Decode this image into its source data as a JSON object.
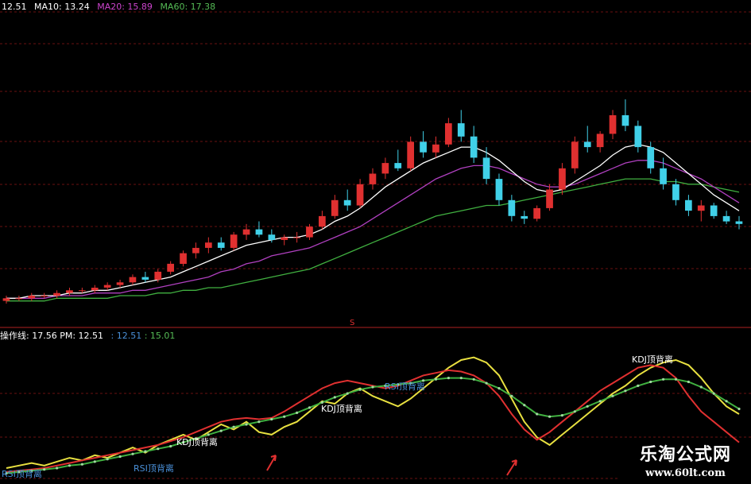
{
  "main_legend": {
    "price": "12.51",
    "ma10": "MA10: 13.24",
    "ma20": "MA20: 15.89",
    "ma60": "MA60: 17.38",
    "colors": {
      "price": "#ffffff",
      "ma10": "#ffffff",
      "ma20": "#cc44cc",
      "ma60": "#55bb55"
    }
  },
  "sub_legend": {
    "label": "操作线: 17.56  PM: 12.51",
    "v1": ": 12.51",
    "v2": ": 15.01",
    "colors": {
      "label": "#ffffff",
      "v1": "#4a90d9",
      "v2": "#55bb55"
    }
  },
  "divider_marker": "S",
  "watermark": {
    "name": "乐淘公式网",
    "url": "www.60lt.com"
  },
  "chart_data": [
    {
      "type": "candlestick",
      "title": "",
      "ylim": [
        0.25,
        1.05
      ],
      "note": "normalized price scale; no axis printed",
      "series_colors": {
        "up": "#e03030",
        "down": "#40d0e8",
        "ma10": "#ffffff",
        "ma5": "#e8d8a0",
        "ma20": "#b040c0",
        "ma60": "#40b040"
      },
      "candles": [
        {
          "o": 0.26,
          "h": 0.28,
          "l": 0.25,
          "c": 0.27
        },
        {
          "o": 0.27,
          "h": 0.28,
          "l": 0.26,
          "c": 0.27
        },
        {
          "o": 0.27,
          "h": 0.29,
          "l": 0.26,
          "c": 0.28
        },
        {
          "o": 0.28,
          "h": 0.29,
          "l": 0.27,
          "c": 0.28
        },
        {
          "o": 0.28,
          "h": 0.3,
          "l": 0.27,
          "c": 0.29
        },
        {
          "o": 0.29,
          "h": 0.31,
          "l": 0.28,
          "c": 0.3
        },
        {
          "o": 0.3,
          "h": 0.31,
          "l": 0.29,
          "c": 0.3
        },
        {
          "o": 0.3,
          "h": 0.32,
          "l": 0.29,
          "c": 0.31
        },
        {
          "o": 0.31,
          "h": 0.33,
          "l": 0.3,
          "c": 0.32
        },
        {
          "o": 0.32,
          "h": 0.34,
          "l": 0.31,
          "c": 0.33
        },
        {
          "o": 0.33,
          "h": 0.36,
          "l": 0.32,
          "c": 0.35
        },
        {
          "o": 0.35,
          "h": 0.37,
          "l": 0.33,
          "c": 0.34
        },
        {
          "o": 0.34,
          "h": 0.38,
          "l": 0.33,
          "c": 0.37
        },
        {
          "o": 0.37,
          "h": 0.41,
          "l": 0.36,
          "c": 0.4
        },
        {
          "o": 0.4,
          "h": 0.45,
          "l": 0.39,
          "c": 0.44
        },
        {
          "o": 0.44,
          "h": 0.48,
          "l": 0.42,
          "c": 0.46
        },
        {
          "o": 0.46,
          "h": 0.5,
          "l": 0.44,
          "c": 0.48
        },
        {
          "o": 0.48,
          "h": 0.5,
          "l": 0.45,
          "c": 0.46
        },
        {
          "o": 0.46,
          "h": 0.52,
          "l": 0.45,
          "c": 0.51
        },
        {
          "o": 0.51,
          "h": 0.55,
          "l": 0.49,
          "c": 0.53
        },
        {
          "o": 0.53,
          "h": 0.56,
          "l": 0.5,
          "c": 0.51
        },
        {
          "o": 0.51,
          "h": 0.53,
          "l": 0.48,
          "c": 0.49
        },
        {
          "o": 0.49,
          "h": 0.51,
          "l": 0.47,
          "c": 0.5
        },
        {
          "o": 0.5,
          "h": 0.52,
          "l": 0.48,
          "c": 0.5
        },
        {
          "o": 0.5,
          "h": 0.55,
          "l": 0.49,
          "c": 0.54
        },
        {
          "o": 0.54,
          "h": 0.6,
          "l": 0.53,
          "c": 0.58
        },
        {
          "o": 0.58,
          "h": 0.66,
          "l": 0.57,
          "c": 0.64
        },
        {
          "o": 0.64,
          "h": 0.68,
          "l": 0.6,
          "c": 0.62
        },
        {
          "o": 0.62,
          "h": 0.72,
          "l": 0.61,
          "c": 0.7
        },
        {
          "o": 0.7,
          "h": 0.76,
          "l": 0.68,
          "c": 0.74
        },
        {
          "o": 0.74,
          "h": 0.8,
          "l": 0.72,
          "c": 0.78
        },
        {
          "o": 0.78,
          "h": 0.83,
          "l": 0.75,
          "c": 0.76
        },
        {
          "o": 0.76,
          "h": 0.88,
          "l": 0.75,
          "c": 0.86
        },
        {
          "o": 0.86,
          "h": 0.9,
          "l": 0.8,
          "c": 0.82
        },
        {
          "o": 0.82,
          "h": 0.88,
          "l": 0.8,
          "c": 0.85
        },
        {
          "o": 0.85,
          "h": 0.95,
          "l": 0.84,
          "c": 0.93
        },
        {
          "o": 0.93,
          "h": 0.98,
          "l": 0.86,
          "c": 0.88
        },
        {
          "o": 0.88,
          "h": 0.92,
          "l": 0.78,
          "c": 0.8
        },
        {
          "o": 0.8,
          "h": 0.84,
          "l": 0.7,
          "c": 0.72
        },
        {
          "o": 0.72,
          "h": 0.74,
          "l": 0.62,
          "c": 0.64
        },
        {
          "o": 0.64,
          "h": 0.66,
          "l": 0.56,
          "c": 0.58
        },
        {
          "o": 0.58,
          "h": 0.6,
          "l": 0.55,
          "c": 0.57
        },
        {
          "o": 0.57,
          "h": 0.62,
          "l": 0.56,
          "c": 0.61
        },
        {
          "o": 0.61,
          "h": 0.7,
          "l": 0.6,
          "c": 0.68
        },
        {
          "o": 0.68,
          "h": 0.78,
          "l": 0.66,
          "c": 0.76
        },
        {
          "o": 0.76,
          "h": 0.88,
          "l": 0.74,
          "c": 0.86
        },
        {
          "o": 0.86,
          "h": 0.92,
          "l": 0.82,
          "c": 0.84
        },
        {
          "o": 0.84,
          "h": 0.9,
          "l": 0.82,
          "c": 0.89
        },
        {
          "o": 0.89,
          "h": 0.98,
          "l": 0.87,
          "c": 0.96
        },
        {
          "o": 0.96,
          "h": 1.02,
          "l": 0.9,
          "c": 0.92
        },
        {
          "o": 0.92,
          "h": 0.94,
          "l": 0.82,
          "c": 0.84
        },
        {
          "o": 0.84,
          "h": 0.86,
          "l": 0.74,
          "c": 0.76
        },
        {
          "o": 0.76,
          "h": 0.8,
          "l": 0.68,
          "c": 0.7
        },
        {
          "o": 0.7,
          "h": 0.72,
          "l": 0.62,
          "c": 0.64
        },
        {
          "o": 0.64,
          "h": 0.66,
          "l": 0.58,
          "c": 0.6
        },
        {
          "o": 0.6,
          "h": 0.64,
          "l": 0.56,
          "c": 0.62
        },
        {
          "o": 0.62,
          "h": 0.63,
          "l": 0.57,
          "c": 0.58
        },
        {
          "o": 0.58,
          "h": 0.6,
          "l": 0.55,
          "c": 0.56
        },
        {
          "o": 0.56,
          "h": 0.58,
          "l": 0.53,
          "c": 0.55
        }
      ],
      "ma10": [
        0.27,
        0.27,
        0.28,
        0.28,
        0.28,
        0.29,
        0.29,
        0.3,
        0.3,
        0.31,
        0.32,
        0.33,
        0.34,
        0.35,
        0.37,
        0.39,
        0.41,
        0.43,
        0.45,
        0.47,
        0.48,
        0.49,
        0.5,
        0.5,
        0.51,
        0.53,
        0.56,
        0.58,
        0.61,
        0.65,
        0.69,
        0.72,
        0.75,
        0.78,
        0.8,
        0.82,
        0.84,
        0.84,
        0.82,
        0.79,
        0.75,
        0.71,
        0.68,
        0.67,
        0.68,
        0.71,
        0.74,
        0.77,
        0.81,
        0.84,
        0.85,
        0.84,
        0.82,
        0.78,
        0.74,
        0.7,
        0.66,
        0.63,
        0.6
      ],
      "ma20": [
        0.27,
        0.27,
        0.27,
        0.27,
        0.28,
        0.28,
        0.28,
        0.29,
        0.29,
        0.29,
        0.3,
        0.3,
        0.31,
        0.32,
        0.33,
        0.34,
        0.35,
        0.37,
        0.38,
        0.4,
        0.41,
        0.43,
        0.44,
        0.45,
        0.46,
        0.48,
        0.5,
        0.52,
        0.54,
        0.57,
        0.6,
        0.63,
        0.66,
        0.69,
        0.72,
        0.74,
        0.76,
        0.77,
        0.77,
        0.76,
        0.74,
        0.72,
        0.7,
        0.69,
        0.69,
        0.7,
        0.72,
        0.74,
        0.76,
        0.78,
        0.79,
        0.79,
        0.78,
        0.76,
        0.74,
        0.72,
        0.69,
        0.66,
        0.63
      ],
      "ma60": [
        0.26,
        0.26,
        0.26,
        0.26,
        0.27,
        0.27,
        0.27,
        0.27,
        0.27,
        0.28,
        0.28,
        0.28,
        0.29,
        0.29,
        0.3,
        0.3,
        0.31,
        0.31,
        0.32,
        0.33,
        0.34,
        0.35,
        0.36,
        0.37,
        0.38,
        0.4,
        0.42,
        0.44,
        0.46,
        0.48,
        0.5,
        0.52,
        0.54,
        0.56,
        0.58,
        0.59,
        0.6,
        0.61,
        0.62,
        0.62,
        0.63,
        0.64,
        0.65,
        0.66,
        0.67,
        0.68,
        0.69,
        0.7,
        0.71,
        0.72,
        0.72,
        0.72,
        0.71,
        0.71,
        0.7,
        0.7,
        0.69,
        0.68,
        0.67
      ]
    },
    {
      "type": "line",
      "title": "",
      "ylim": [
        0,
        1
      ],
      "note": "oscillator panel; normalized scale; no axis printed",
      "x": [
        0,
        1,
        2,
        3,
        4,
        5,
        6,
        7,
        8,
        9,
        10,
        11,
        12,
        13,
        14,
        15,
        16,
        17,
        18,
        19,
        20,
        21,
        22,
        23,
        24,
        25,
        26,
        27,
        28,
        29,
        30,
        31,
        32,
        33,
        34,
        35,
        36,
        37,
        38,
        39,
        40,
        41,
        42,
        43,
        44,
        45,
        46,
        47,
        48,
        49,
        50,
        51,
        52,
        53,
        54,
        55,
        56,
        57,
        58
      ],
      "series": [
        {
          "name": "",
          "color": "#e8e040",
          "values": [
            0.08,
            0.1,
            0.12,
            0.1,
            0.13,
            0.16,
            0.14,
            0.18,
            0.16,
            0.2,
            0.24,
            0.2,
            0.26,
            0.3,
            0.34,
            0.3,
            0.36,
            0.42,
            0.38,
            0.44,
            0.36,
            0.34,
            0.4,
            0.44,
            0.52,
            0.6,
            0.58,
            0.66,
            0.7,
            0.64,
            0.6,
            0.56,
            0.62,
            0.7,
            0.78,
            0.86,
            0.92,
            0.94,
            0.9,
            0.8,
            0.62,
            0.44,
            0.32,
            0.26,
            0.34,
            0.42,
            0.5,
            0.58,
            0.66,
            0.72,
            0.8,
            0.86,
            0.9,
            0.92,
            0.88,
            0.78,
            0.66,
            0.56,
            0.5
          ]
        },
        {
          "name": "",
          "color": "#e03030",
          "values": [
            0.05,
            0.06,
            0.07,
            0.08,
            0.1,
            0.12,
            0.14,
            0.16,
            0.18,
            0.2,
            0.22,
            0.24,
            0.26,
            0.29,
            0.32,
            0.36,
            0.4,
            0.44,
            0.46,
            0.47,
            0.46,
            0.47,
            0.52,
            0.58,
            0.64,
            0.7,
            0.74,
            0.76,
            0.74,
            0.72,
            0.7,
            0.72,
            0.76,
            0.8,
            0.82,
            0.84,
            0.83,
            0.8,
            0.74,
            0.64,
            0.5,
            0.38,
            0.3,
            0.36,
            0.44,
            0.52,
            0.6,
            0.68,
            0.74,
            0.8,
            0.86,
            0.88,
            0.86,
            0.78,
            0.64,
            0.52,
            0.44,
            0.36,
            0.28
          ]
        },
        {
          "name": "",
          "color": "#40b040",
          "values": [
            0.04,
            0.05,
            0.06,
            0.07,
            0.08,
            0.1,
            0.11,
            0.13,
            0.15,
            0.17,
            0.19,
            0.21,
            0.23,
            0.25,
            0.28,
            0.31,
            0.34,
            0.37,
            0.4,
            0.42,
            0.44,
            0.46,
            0.48,
            0.51,
            0.55,
            0.59,
            0.63,
            0.66,
            0.69,
            0.71,
            0.72,
            0.73,
            0.74,
            0.76,
            0.77,
            0.78,
            0.78,
            0.77,
            0.74,
            0.7,
            0.64,
            0.57,
            0.5,
            0.48,
            0.49,
            0.52,
            0.56,
            0.6,
            0.64,
            0.68,
            0.72,
            0.75,
            0.77,
            0.77,
            0.75,
            0.71,
            0.66,
            0.6,
            0.54
          ]
        }
      ],
      "annotations": [
        "RSI顶背离",
        "RSI顶背离",
        "KDJ顶背离",
        "RSI顶背离",
        "KDJ顶背离",
        "KDJ顶背离"
      ]
    }
  ]
}
